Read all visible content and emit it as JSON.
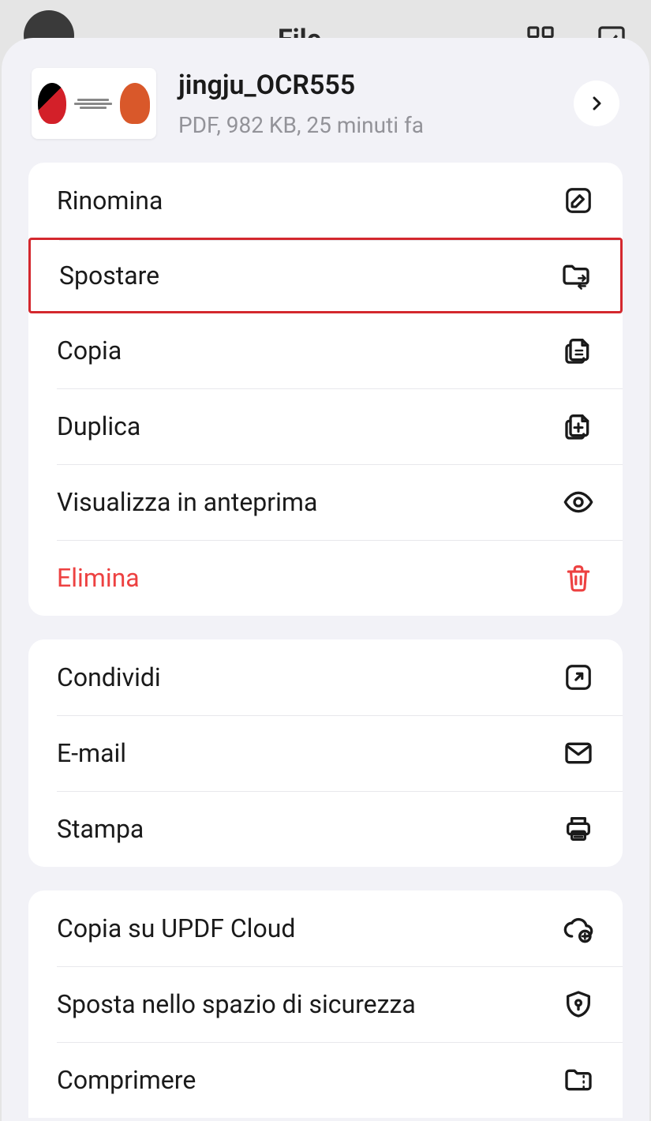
{
  "backdrop": {
    "title": "File"
  },
  "file": {
    "name": "jingju_OCR555",
    "meta": "PDF, 982 KB, 25 minuti fa"
  },
  "section1": {
    "rename": "Rinomina",
    "move": "Spostare",
    "copy": "Copia",
    "duplicate": "Duplica",
    "preview": "Visualizza in anteprima",
    "delete": "Elimina"
  },
  "section2": {
    "share": "Condividi",
    "email": "E-mail",
    "print": "Stampa"
  },
  "section3": {
    "cloud": "Copia su UPDF Cloud",
    "secure": "Sposta nello spazio di sicurezza",
    "compress": "Comprimere"
  }
}
